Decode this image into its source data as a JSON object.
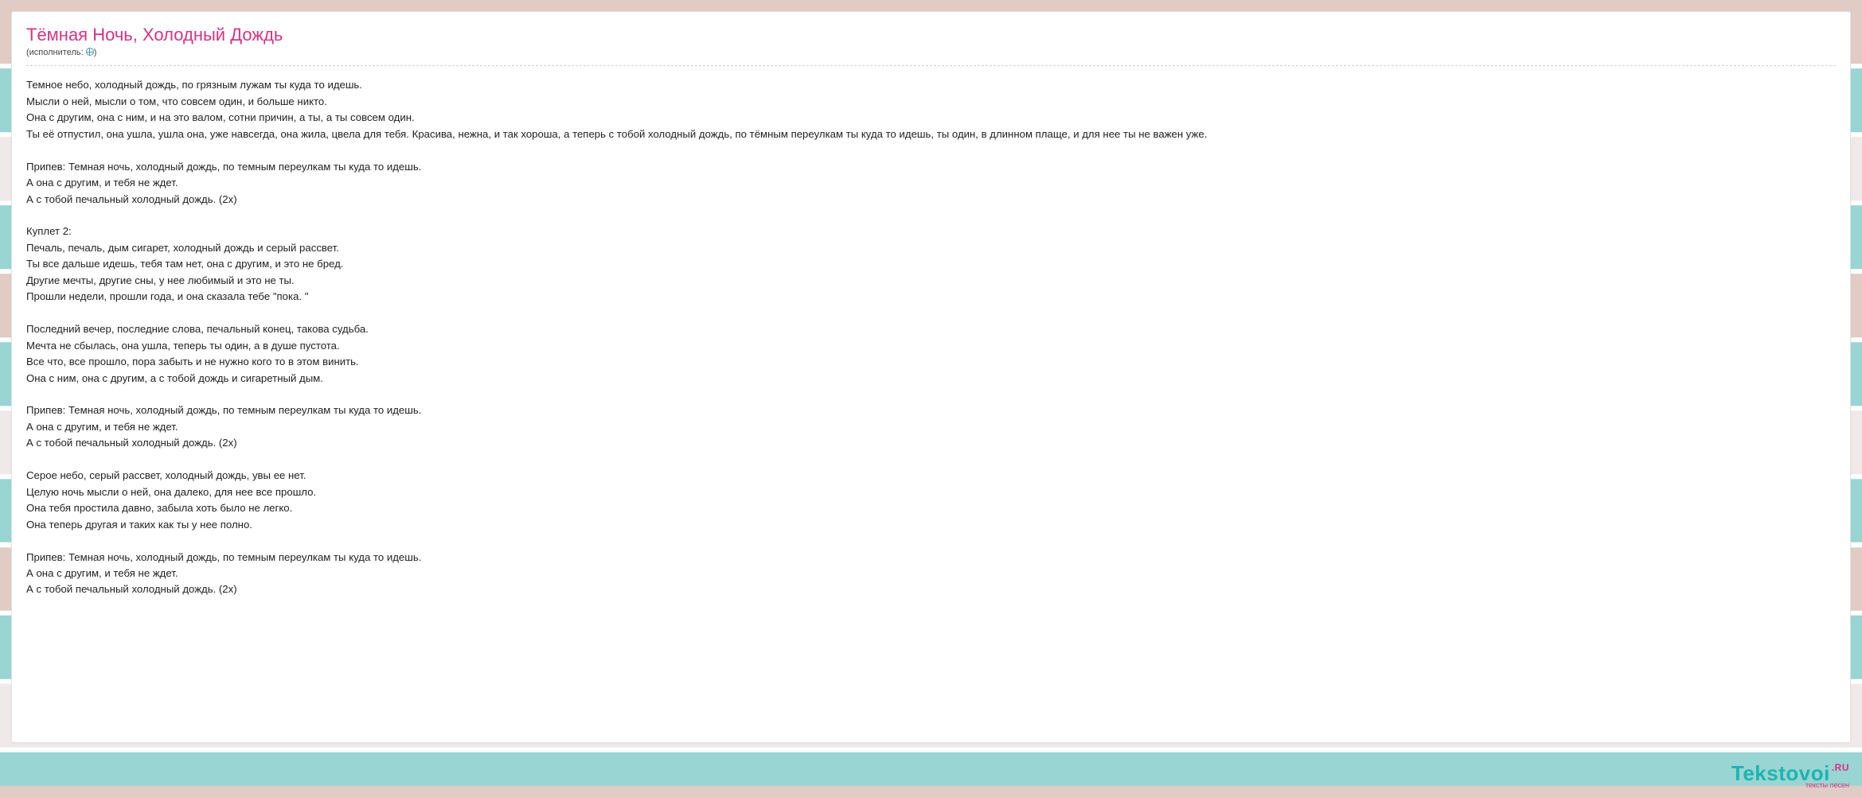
{
  "title": "Тёмная Ночь, Холодный Дождь",
  "performer_label": "(исполнитель: ",
  "performer_link_text": "",
  "performer_close": ")",
  "lyrics": "Темное небо, холодный дождь, по грязным лужам ты куда то идешь.\nМысли о ней, мысли о том, что совсем один, и больше никто.\nОна с другим, она с ним, и на это валом, сотни причин, а ты, а ты совсем один.\nТы её отпустил, она ушла, ушла она, уже навсегда, она жила, цвела для тебя. Красива, нежна, и так хороша, а теперь с тобой холодный дождь, по тёмным переулкам ты куда то идешь, ты один, в длинном плаще, и для нее ты не важен уже.\n\nПрипев: Темная ночь, холодный дождь, по темным переулкам ты куда то идешь.\nА она с другим, и тебя не ждет.\nА с тобой печальный холодный дождь. (2х)\n\nКуплет 2:\nПечаль, печаль, дым сигарет, холодный дождь и серый рассвет.\nТы все дальше идешь, тебя там нет, она с другим, и это не бред.\nДругие мечты, другие сны, у нее любимый и это не ты.\nПрошли недели, прошли года, и она сказала тебе \"пока. \"\n\nПоследний вечер, последние слова, печальный конец, такова судьба.\nМечта не сбылась, она ушла, теперь ты один, а в душе пустота.\nВсе что, все прошло, пора забыть и не нужно кого то в этом винить.\nОна с ним, она с другим, а с тобой дождь и сигаретный дым.\n\nПрипев: Темная ночь, холодный дождь, по темным переулкам ты куда то идешь.\nА она с другим, и тебя не ждет.\nА с тобой печальный холодный дождь. (2х)\n\nСерое небо, серый рассвет, холодный дождь, увы ее нет.\nЦелую ночь мысли о ней, она далеко, для нее все прошло.\nОна тебя простила давно, забыла хоть было не легко.\nОна теперь другая и таких как ты у нее полно.\n\nПрипев: Темная ночь, холодный дождь, по темным переулкам ты куда то идешь.\nА она с другим, и тебя не ждет.\nА с тобой печальный холодный дождь. (2х)",
  "brand": {
    "name": "Tekstovoi",
    "tld": ".RU",
    "tagline": "тексты песен"
  }
}
